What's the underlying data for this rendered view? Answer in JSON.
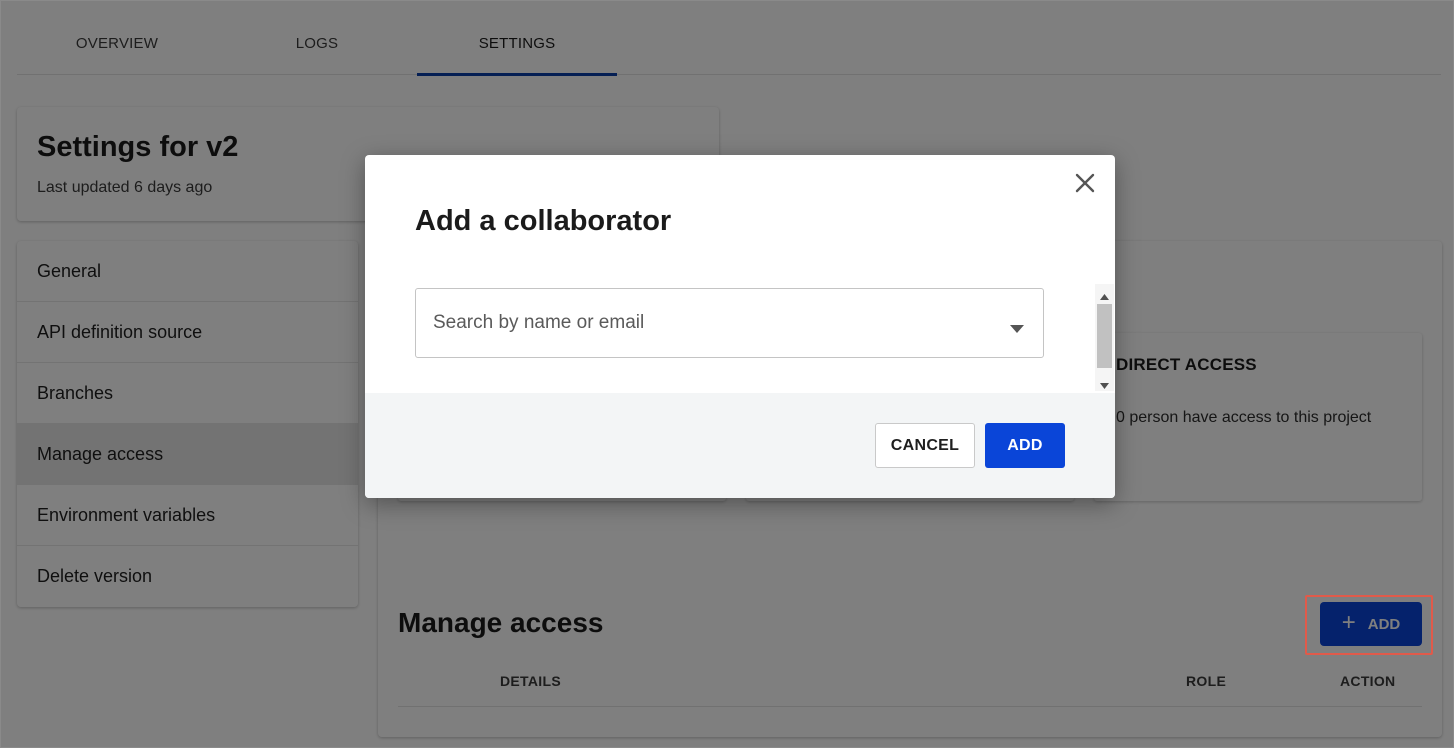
{
  "tabs": [
    {
      "label": "OVERVIEW"
    },
    {
      "label": "LOGS"
    },
    {
      "label": "SETTINGS",
      "active": true
    }
  ],
  "header": {
    "title": "Settings for v2",
    "updated": "Last updated 6 days ago"
  },
  "sidebar": {
    "items": [
      {
        "label": "General"
      },
      {
        "label": "API definition source"
      },
      {
        "label": "Branches"
      },
      {
        "label": "Manage access",
        "selected": true
      },
      {
        "label": "Environment variables"
      },
      {
        "label": "Delete version"
      }
    ]
  },
  "main": {
    "direct_access": {
      "title": "DIRECT ACCESS",
      "text": "0 person have access to this project"
    },
    "section_title": "Manage access",
    "add_button": {
      "label": "ADD",
      "icon": "plus-icon"
    },
    "table": {
      "columns": [
        "DETAILS",
        "ROLE",
        "ACTION"
      ]
    }
  },
  "modal": {
    "title": "Add a collaborator",
    "close_icon": "close-icon",
    "search": {
      "placeholder": "Search by name or email",
      "value": ""
    },
    "cancel_label": "CANCEL",
    "add_label": "ADD"
  },
  "colors": {
    "primary": "#0a45d8",
    "tab_indicator": "#0b3ea8",
    "highlight_border": "#e05a4a",
    "overlay": "rgba(0,0,0,0.5)"
  }
}
